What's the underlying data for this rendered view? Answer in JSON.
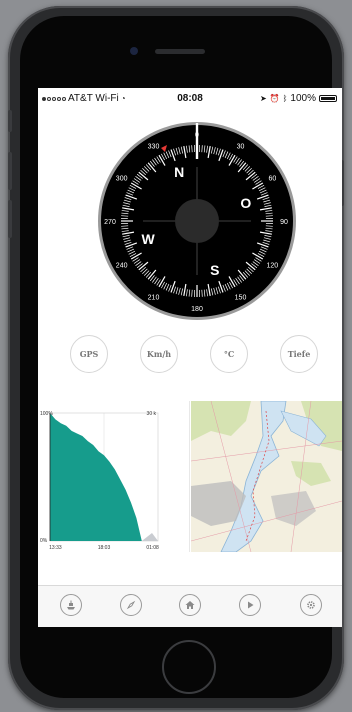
{
  "status_bar": {
    "carrier": "AT&T Wi-Fi",
    "time": "08:08",
    "battery": "100%",
    "signal_dots_filled": 1,
    "signal_dots_total": 5
  },
  "compass": {
    "heading_deg": 0,
    "cardinals": {
      "north": "N",
      "east": "O",
      "south": "S",
      "west": "W"
    },
    "degree_labels": [
      "0",
      "30",
      "60",
      "90",
      "120",
      "150",
      "180",
      "210",
      "240",
      "270",
      "300",
      "330"
    ],
    "colors": {
      "dial": "#000000",
      "needle": "#ffffff",
      "marker": "#e53935"
    }
  },
  "sensors": [
    {
      "label": "GPS"
    },
    {
      "label": "Km/h"
    },
    {
      "label": "°C"
    },
    {
      "label": "Tiefe"
    }
  ],
  "chart_data": {
    "type": "area",
    "y_top_label": "100%",
    "y_bottom_label": "0%",
    "right_top_label": "30 k",
    "x_tick_labels": [
      "13:33",
      "18:03",
      "01:08"
    ],
    "x": [
      0,
      0.05,
      0.1,
      0.15,
      0.2,
      0.25,
      0.3,
      0.35,
      0.4,
      0.45,
      0.5,
      0.55,
      0.6,
      0.65,
      0.7,
      0.75,
      0.8,
      0.85
    ],
    "values": [
      100,
      95,
      92,
      90,
      86,
      84,
      82,
      78,
      75,
      70,
      67,
      62,
      56,
      48,
      40,
      30,
      18,
      0
    ],
    "ylim": [
      0,
      100
    ],
    "fill_color": "#169c8c",
    "remainder_color": "#c9ccd1"
  },
  "map": {
    "colors": {
      "land": "#f3efdf",
      "water": "#cfe3f2",
      "urban": "#bdbdbd",
      "forest": "#d6e3b2"
    }
  },
  "tab_bar": [
    {
      "icon": "ship-icon"
    },
    {
      "icon": "compass-icon"
    },
    {
      "icon": "home-icon"
    },
    {
      "icon": "play-icon"
    },
    {
      "icon": "gear-icon"
    }
  ]
}
